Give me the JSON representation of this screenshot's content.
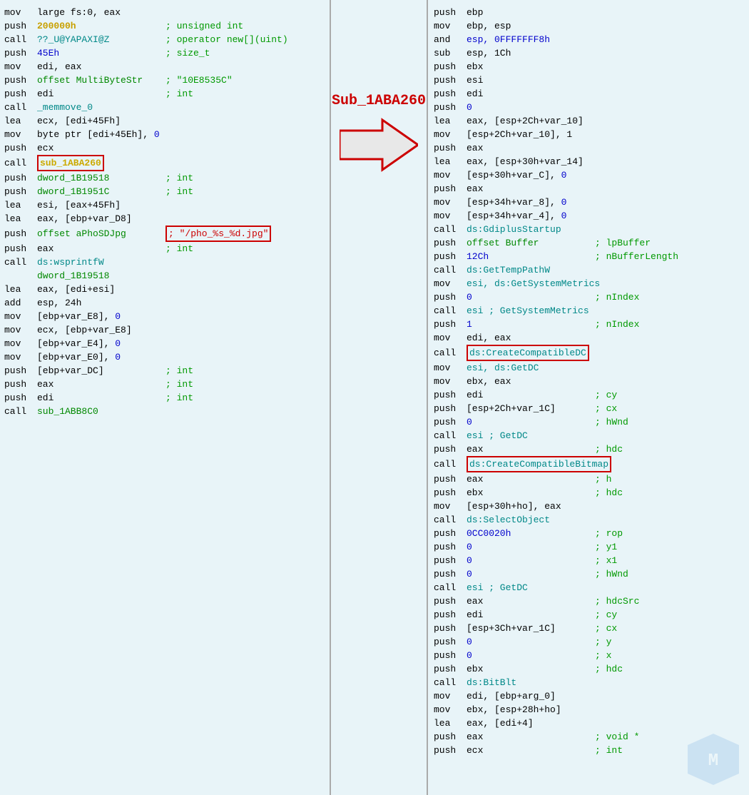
{
  "left": {
    "lines": [
      {
        "mn": "mov",
        "op": "large fs:0, eax",
        "comment": ""
      },
      {
        "mn": "push",
        "op": "200000h",
        "comment": "; unsigned int",
        "op_class": "num-yellow"
      },
      {
        "mn": "call",
        "op": "??_U@YAPAXI@Z",
        "comment": "; operator new[](uint)",
        "op_class": "fn-cyan"
      },
      {
        "mn": "push",
        "op": "45Eh",
        "comment": "; size_t",
        "op_class": "num-blue"
      },
      {
        "mn": "mov",
        "op": "edi, eax",
        "comment": ""
      },
      {
        "mn": "push",
        "op": "offset MultiByteStr",
        "comment": "; \"10E8535C\"",
        "op_class": "fn-green"
      },
      {
        "mn": "push",
        "op": "edi",
        "comment": "; int"
      },
      {
        "mn": "call",
        "op": "_memmove_0",
        "comment": "",
        "op_class": "fn-cyan"
      },
      {
        "mn": "lea",
        "op": "ecx, [edi+45Fh]",
        "comment": ""
      },
      {
        "mn": "mov",
        "op": "byte ptr [edi+45Eh], 0",
        "comment": "",
        "zero_class": "num-zero"
      },
      {
        "mn": "push",
        "op": "ecx",
        "comment": ""
      },
      {
        "mn": "call",
        "op": "sub_1ABA260",
        "comment": "",
        "op_class": "label-yellow",
        "highlight": true
      },
      {
        "mn": "push",
        "op": "dword_1B19518",
        "comment": "; int",
        "op_class": "fn-green"
      },
      {
        "mn": "push",
        "op": "dword_1B1951C",
        "comment": "; int",
        "op_class": "fn-green"
      },
      {
        "mn": "lea",
        "op": "esi, [eax+45Fh]",
        "comment": ""
      },
      {
        "mn": "lea",
        "op": "eax, [ebp+var_D8]",
        "comment": ""
      },
      {
        "mn": "push",
        "op": "offset aPhoSDJpg",
        "comment": "; \"/pho_%s_%d.jpg\"",
        "op_class": "fn-green",
        "comment_highlight": true
      },
      {
        "mn": "push",
        "op": "eax",
        "comment": "; int"
      },
      {
        "mn": "call",
        "op": "ds:wsprintfW",
        "comment": "",
        "op_class": "fn-cyan"
      },
      {
        "mn": "",
        "op": "dword_1B19518",
        "comment": "",
        "op_class": "fn-green"
      },
      {
        "mn": "lea",
        "op": "eax, [edi+esi]",
        "comment": ""
      },
      {
        "mn": "add",
        "op": "esp, 24h",
        "comment": ""
      },
      {
        "mn": "mov",
        "op": "[ebp+var_E8], 0",
        "comment": "",
        "zero_class": "num-zero"
      },
      {
        "mn": "mov",
        "op": "ecx, [ebp+var_E8]",
        "comment": ""
      },
      {
        "mn": "mov",
        "op": "[ebp+var_E4], 0",
        "comment": "",
        "zero_class": "num-zero"
      },
      {
        "mn": "mov",
        "op": "[ebp+var_E0], 0",
        "comment": "",
        "zero_class": "num-zero"
      },
      {
        "mn": "push",
        "op": "[ebp+var_DC]",
        "comment": "; int"
      },
      {
        "mn": "push",
        "op": "eax",
        "comment": "; int"
      },
      {
        "mn": "push",
        "op": "edi",
        "comment": "; int"
      },
      {
        "mn": "call",
        "op": "sub_1ABB8C0",
        "comment": "",
        "op_class": "fn-green"
      }
    ]
  },
  "middle": {
    "title": "Sub_1ABA260",
    "arrow": "→"
  },
  "right": {
    "lines": [
      {
        "mn": "push",
        "op": "ebp",
        "comment": ""
      },
      {
        "mn": "mov",
        "op": "ebp, esp",
        "comment": ""
      },
      {
        "mn": "and",
        "op": "esp, 0FFFFFFF8h",
        "comment": "",
        "op_class": "num-blue"
      },
      {
        "mn": "sub",
        "op": "esp, 1Ch",
        "comment": ""
      },
      {
        "mn": "push",
        "op": "ebx",
        "comment": ""
      },
      {
        "mn": "push",
        "op": "esi",
        "comment": ""
      },
      {
        "mn": "push",
        "op": "edi",
        "comment": ""
      },
      {
        "mn": "push",
        "op": "0",
        "comment": "",
        "op_class": "num-zero"
      },
      {
        "mn": "lea",
        "op": "eax, [esp+2Ch+var_10]",
        "comment": ""
      },
      {
        "mn": "mov",
        "op": "[esp+2Ch+var_10], 1",
        "comment": "",
        "zero_class": "num-zero"
      },
      {
        "mn": "push",
        "op": "eax",
        "comment": ""
      },
      {
        "mn": "lea",
        "op": "eax, [esp+30h+var_14]",
        "comment": ""
      },
      {
        "mn": "mov",
        "op": "[esp+30h+var_C], 0",
        "comment": "",
        "zero_class": "num-zero"
      },
      {
        "mn": "push",
        "op": "eax",
        "comment": ""
      },
      {
        "mn": "mov",
        "op": "[esp+34h+var_8], 0",
        "comment": "",
        "zero_class": "num-zero"
      },
      {
        "mn": "mov",
        "op": "[esp+34h+var_4], 0",
        "comment": "",
        "zero_class": "num-zero"
      },
      {
        "mn": "call",
        "op": "ds:GdiplusStartup",
        "comment": "",
        "op_class": "fn-cyan"
      },
      {
        "mn": "push",
        "op": "offset Buffer",
        "comment": "; lpBuffer",
        "op_class": "fn-green"
      },
      {
        "mn": "push",
        "op": "12Ch",
        "comment": "; nBufferLength",
        "op_class": "num-blue"
      },
      {
        "mn": "call",
        "op": "ds:GetTempPathW",
        "comment": "",
        "op_class": "fn-cyan"
      },
      {
        "mn": "mov",
        "op": "esi, ds:GetSystemMetrics",
        "comment": "",
        "op_class": "fn-cyan"
      },
      {
        "mn": "push",
        "op": "0",
        "comment": "; nIndex",
        "op_class": "num-zero"
      },
      {
        "mn": "call",
        "op": "esi ; GetSystemMetrics",
        "comment": "",
        "op_class": "fn-cyan"
      },
      {
        "mn": "push",
        "op": "1",
        "comment": "; nIndex",
        "op_class": "num-zero"
      },
      {
        "mn": "mov",
        "op": "edi, eax",
        "comment": ""
      },
      {
        "mn": "call",
        "op": "ds:CreateCompatibleDC",
        "comment": "",
        "op_class": "fn-cyan",
        "highlight": true
      },
      {
        "mn": "mov",
        "op": "esi, ds:GetDC",
        "comment": "",
        "op_class": "fn-cyan"
      },
      {
        "mn": "mov",
        "op": "ebx, eax",
        "comment": ""
      },
      {
        "mn": "push",
        "op": "edi",
        "comment": "; cy"
      },
      {
        "mn": "push",
        "op": "[esp+2Ch+var_1C]",
        "comment": "; cx"
      },
      {
        "mn": "push",
        "op": "0",
        "comment": "; hWnd",
        "op_class": "num-zero"
      },
      {
        "mn": "call",
        "op": "esi ; GetDC",
        "comment": "",
        "op_class": "fn-cyan"
      },
      {
        "mn": "push",
        "op": "eax",
        "comment": "; hdc"
      },
      {
        "mn": "call",
        "op": "ds:CreateCompatibleBitmap",
        "comment": "",
        "op_class": "fn-cyan",
        "highlight": true
      },
      {
        "mn": "push",
        "op": "eax",
        "comment": "; h"
      },
      {
        "mn": "push",
        "op": "ebx",
        "comment": "; hdc"
      },
      {
        "mn": "mov",
        "op": "[esp+30h+ho], eax",
        "comment": ""
      },
      {
        "mn": "call",
        "op": "ds:SelectObject",
        "comment": "",
        "op_class": "fn-cyan"
      },
      {
        "mn": "push",
        "op": "0CC0020h",
        "comment": "; rop",
        "op_class": "num-blue"
      },
      {
        "mn": "push",
        "op": "0",
        "comment": "; y1",
        "op_class": "num-zero"
      },
      {
        "mn": "push",
        "op": "0",
        "comment": "; x1",
        "op_class": "num-zero"
      },
      {
        "mn": "push",
        "op": "0",
        "comment": "; hWnd",
        "op_class": "num-zero"
      },
      {
        "mn": "call",
        "op": "esi ; GetDC",
        "comment": "",
        "op_class": "fn-cyan"
      },
      {
        "mn": "push",
        "op": "eax",
        "comment": "; hdcSrc"
      },
      {
        "mn": "push",
        "op": "edi",
        "comment": "; cy"
      },
      {
        "mn": "push",
        "op": "[esp+3Ch+var_1C]",
        "comment": "; cx"
      },
      {
        "mn": "push",
        "op": "0",
        "comment": "; y",
        "op_class": "num-zero"
      },
      {
        "mn": "push",
        "op": "0",
        "comment": "; x",
        "op_class": "num-zero"
      },
      {
        "mn": "push",
        "op": "ebx",
        "comment": "; hdc"
      },
      {
        "mn": "call",
        "op": "ds:BitBlt",
        "comment": "",
        "op_class": "fn-cyan"
      },
      {
        "mn": "mov",
        "op": "edi, [ebp+arg_0]",
        "comment": ""
      },
      {
        "mn": "mov",
        "op": "ebx, [esp+28h+ho]",
        "comment": ""
      },
      {
        "mn": "lea",
        "op": "eax, [edi+4]",
        "comment": ""
      },
      {
        "mn": "push",
        "op": "eax",
        "comment": "; void *"
      },
      {
        "mn": "push",
        "op": "ecx",
        "comment": "; int"
      }
    ]
  }
}
